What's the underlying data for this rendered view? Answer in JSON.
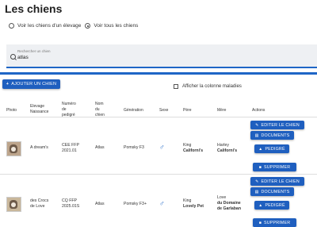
{
  "page": {
    "title": "Les chiens"
  },
  "view_options": {
    "option_breeding": "Voir les chiens d'un élevage",
    "option_all": "Voir tous les chiens",
    "selected": "option_all"
  },
  "search": {
    "label": "Rechercher un chien",
    "value": "atlas"
  },
  "toolbar": {
    "add_label": "AJOUTER UN CHIEN",
    "show_diseases_label": "Afficher la colonne maladies",
    "show_diseases_checked": false
  },
  "table": {
    "headers": {
      "photo": "Photo",
      "elevage_1": "Elevage",
      "elevage_2": "Naissance",
      "pedigree_1": "Numéro",
      "pedigree_2": "de",
      "pedigree_3": "pedigré",
      "nom_1": "Nom",
      "nom_2": "du",
      "nom_3": "chien",
      "generation": "Génération",
      "sexe": "Sexe",
      "pere": "Père",
      "mere": "Mère",
      "actions": "Actions"
    },
    "rows": [
      {
        "elevage": "A dream's",
        "pedigree_1": "CEE FFP",
        "pedigree_2": "2021.01",
        "nom": "Atlas",
        "generation": "Pomsky F3",
        "sexe": "♂",
        "pere_1": "King",
        "pere_2": "Californi’s",
        "mere_1": "Harley",
        "mere_2": "Californi’s"
      },
      {
        "elevage_1": "des Crocs",
        "elevage_2": "de Love",
        "pedigree_1": "CQ FFP",
        "pedigree_2": "2025.01S",
        "nom": "Atlas",
        "generation": "Pomsky F3+",
        "sexe": "♂",
        "pere_1": "King",
        "pere_2": "Lovely Pet",
        "mere_1": "Love",
        "mere_2": "du Domaine",
        "mere_3": "de Garlaban"
      }
    ],
    "actions": {
      "edit": "EDITER LE CHIEN",
      "documents": "DOCUMENTS",
      "pedigree": "PEDIGRÉ",
      "delete": "SUPPRIMER"
    }
  }
}
